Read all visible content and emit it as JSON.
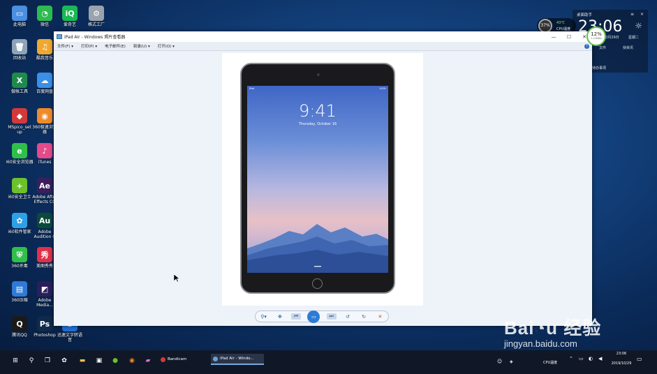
{
  "desktop_icons": [
    {
      "label": "此电脑",
      "icon": "computer-icon",
      "color": "#4a8fe0",
      "glyph": "▭"
    },
    {
      "label": "微信",
      "icon": "wechat-icon",
      "color": "#2dbb4f",
      "glyph": "◔"
    },
    {
      "label": "爱奇艺",
      "icon": "iqiyi-icon",
      "color": "#19b955",
      "glyph": "iQ"
    },
    {
      "label": "格式工厂",
      "icon": "format-factory-icon",
      "color": "#9aa2ad",
      "glyph": "⚙"
    },
    {
      "label": "回收站",
      "icon": "recycle-bin-icon",
      "color": "#8fa3b8",
      "glyph": "🗑"
    },
    {
      "label": "酷我音乐",
      "icon": "kuwo-music-icon",
      "color": "#f0a830",
      "glyph": "♫"
    },
    {
      "label": "做帐工具",
      "icon": "excel-tool-icon",
      "color": "#1f8a4c",
      "glyph": "X"
    },
    {
      "label": "百度网盘",
      "icon": "baidu-netdisk-icon",
      "color": "#3b8fe6",
      "glyph": "☁"
    },
    {
      "label": "MSpico_set up",
      "icon": "mspico-icon",
      "color": "#d23a3a",
      "glyph": "◆"
    },
    {
      "label": "360极速浏览器",
      "icon": "360-browser-icon",
      "color": "#f08a2a",
      "glyph": "◉"
    },
    {
      "label": "i60安全浏览器",
      "icon": "safe-browser-icon",
      "color": "#2fbf4a",
      "glyph": "e"
    },
    {
      "label": "iTunes",
      "icon": "itunes-icon",
      "color": "#e54a8a",
      "glyph": "♪"
    },
    {
      "label": "i60安全卫士",
      "icon": "security-guard-icon",
      "color": "#6cc12c",
      "glyph": "+"
    },
    {
      "label": "Adobe After Effects CC",
      "icon": "after-effects-icon",
      "color": "#3a1f5c",
      "glyph": "Ae"
    },
    {
      "label": "i60软件管家",
      "icon": "software-manager-icon",
      "color": "#2fa0e6",
      "glyph": "✿"
    },
    {
      "label": "Adobe Audition C",
      "icon": "audition-icon",
      "color": "#0b4a3a",
      "glyph": "Au"
    },
    {
      "label": "360杀毒",
      "icon": "360-antivirus-icon",
      "color": "#2fbf4a",
      "glyph": "⛨"
    },
    {
      "label": "美图秀秀",
      "icon": "meitu-icon",
      "color": "#e0304a",
      "glyph": "秀"
    },
    {
      "label": "360压缩",
      "icon": "360-zip-icon",
      "color": "#2f7ad6",
      "glyph": "▤"
    },
    {
      "label": "Adobe Media...",
      "icon": "media-encoder-icon",
      "color": "#2a1f5c",
      "glyph": "◩"
    },
    {
      "label": "腾讯QQ",
      "icon": "qq-icon",
      "color": "#1a1a1a",
      "glyph": "Q"
    },
    {
      "label": "Photoshop",
      "icon": "photoshop-icon",
      "color": "#0f2a4a",
      "glyph": "Ps"
    },
    {
      "label": "迅速文字转语音",
      "icon": "text-to-speech-icon",
      "color": "#1f6fd6",
      "glyph": "U"
    }
  ],
  "window": {
    "title": "iPad Air - Windows 照片查看器",
    "minimize": "—",
    "maximize": "☐",
    "close": "✕",
    "menus": [
      "文件(F) ▾",
      "打印(P) ▾",
      "电子邮件(E)",
      "刻录(U) ▾",
      "打开(O) ▾"
    ],
    "help": "?"
  },
  "ipad": {
    "clock": "9:41",
    "date": "Thursday, October 16",
    "status_left": "iPad",
    "status_right": "100%"
  },
  "controls": {
    "zoom": "⚲▾",
    "fit": "✥",
    "prev": "⏮",
    "play": "▭",
    "next": "⏭",
    "rotate_left": "↺",
    "rotate_right": "↻",
    "delete": "✕"
  },
  "widgets": {
    "cpu_percent": "37%",
    "cpu_temp": "43℃",
    "cpu_label": "CPU温度",
    "net_percent": "12%",
    "net_speed": "1.12Mb/s"
  },
  "side_panel": {
    "title": "桌面助手",
    "menu": "≡",
    "close": "×",
    "time": "23:06",
    "date": "10月29日",
    "weekday": "星期二",
    "file_label": "文件",
    "news_label": "快资讯",
    "todo_label": "待办事项"
  },
  "taskbar": {
    "tasks": [
      {
        "label": "Bandicam",
        "color": "#d23a3a",
        "active": false
      },
      {
        "label": "iPad Air - Windo...",
        "color": "#6aa0d8",
        "active": true
      }
    ],
    "tray_cpu": "CPU温度",
    "tray_time": "23:06",
    "tray_date": "2019/10/29"
  },
  "watermark": {
    "logo": "Bai◔u 经验",
    "url": "jingyan.baidu.com"
  }
}
